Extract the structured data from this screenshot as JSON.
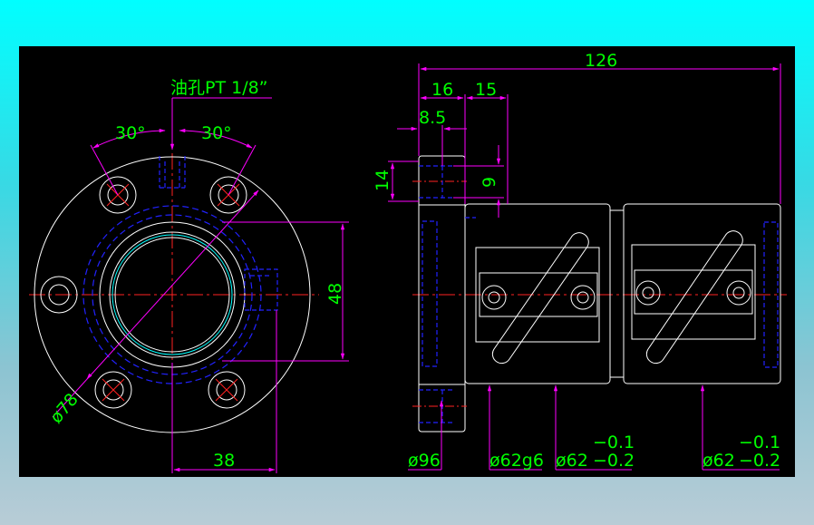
{
  "colors": {
    "outline": "#ffffff",
    "hidden": "#2222ff",
    "center": "#ff2222",
    "dimension": "#ff00ff",
    "dimension_text": "#00ff00",
    "canvas": "#000000"
  },
  "left_view": {
    "oil_hole_label": "油孔PT 1/8”",
    "angle_left": "30°",
    "angle_right": "30°",
    "dim_height": "48",
    "dim_width": "38",
    "dim_bolt_circle": "ø78"
  },
  "right_view": {
    "dim_total_length": "126",
    "dim_flange": "16",
    "dim_pocket": "15",
    "dim_flange_inner": "8.5",
    "dim_hole_pitch": "14",
    "dim_hole_dia": "9",
    "dim_flange_dia": "ø96",
    "dim_body_fit": "ø62g6",
    "dim_body_a": "ø62",
    "tol_a_upper": "−0.1",
    "tol_a_lower": "−0.2",
    "dim_body_b": "ø62",
    "tol_b_upper": "−0.1",
    "tol_b_lower": "−0.2"
  }
}
